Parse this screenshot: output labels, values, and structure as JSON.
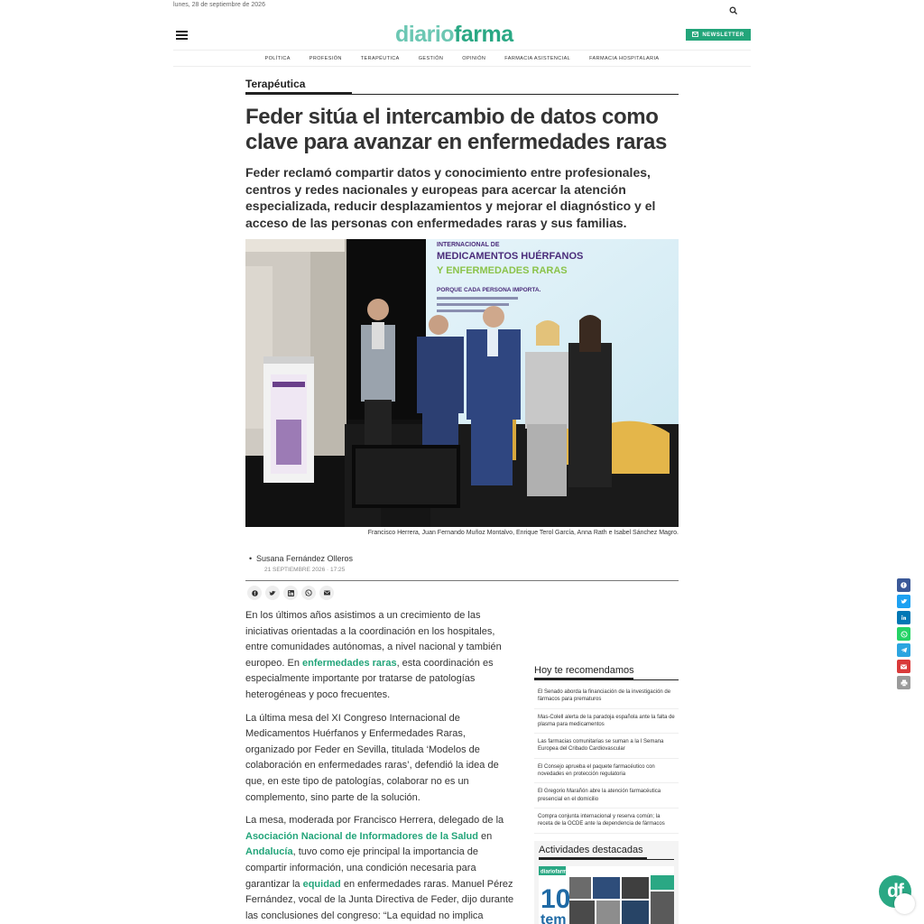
{
  "topbar": {
    "date": "lunes, 28 de septiembre de 2026"
  },
  "header": {
    "logo_part1": "diario",
    "logo_part2": "farma",
    "newsletter_label": "NEWSLETTER"
  },
  "nav": {
    "items": [
      "POLÍTICA",
      "PROFESIÓN",
      "TERAPÉUTICA",
      "GESTIÓN",
      "OPINIÓN",
      "FARMACIA ASISTENCIAL",
      "FARMACIA HOSPITALARIA"
    ]
  },
  "article": {
    "section": "Terapéutica",
    "title": "Feder sitúa el intercambio de datos como clave para avanzar en enfermedades raras",
    "subtitle": "Feder reclamó compartir datos y conocimiento entre profesionales, centros y redes nacionales y europeas para acercar la atención especializada, reducir desplazamientos y mejorar el diagnóstico y el acceso de las personas con enfermedades raras y sus familias.",
    "caption": "Francisco Herrera, Juan Fernando Muñoz Montalvo, Enrique Terol García, Anna Rath e Isabel Sánchez Magro.",
    "author": "Susana Fernández Olleros",
    "date": "21 SEPTIEMBRE 2026 · 17:25",
    "photo_text": {
      "l1": "INTERNACIONAL DE",
      "l2": "MEDICAMENTOS HUÉRFANOS",
      "l3": "Y ENFERMEDADES RARAS",
      "l4": "PORQUE CADA PERSONA IMPORTA."
    },
    "p1": {
      "a": "En los últimos años asistimos a un crecimiento de las iniciativas orientadas a la coordinación en los hospitales, entre comunidades autónomas, a nivel nacional y también europeo. En ",
      "link": "enfermedades raras",
      "b": ", esta coordinación es especialmente importante por tratarse de patologías heterogéneas y poco frecuentes."
    },
    "p2": "La última mesa del XI Congreso Internacional de Medicamentos Huérfanos y Enfermedades Raras, organizado por Feder en Sevilla, titulada ‘Modelos de colaboración en enfermedades raras’, defendió la idea de que, en este tipo de patologías, colaborar no es un complemento, sino parte de la solución.",
    "p3": {
      "a": "La mesa, moderada por Francisco Herrera, delegado de la ",
      "link1": "Asociación Nacional de Informadores de la Salud",
      "b": " en ",
      "link2": "Andalucía",
      "c": ", tuvo como eje principal la importancia de compartir información, una condición necesaria para garantizar la ",
      "link3": "equidad",
      "d": " en enfermedades raras. Manuel Pérez Fernández, vocal de la Junta Directiva de Feder, dijo durante las conclusiones del congreso: “La equidad no implica"
    }
  },
  "sidebar": {
    "reco_title": "Hoy te recomendamos",
    "reco_items": [
      "El Senado aborda la financiación de la investigación de fármacos para prematuros",
      "Mas-Colell alerta de la paradoja española ante la falta de plasma para medicamentos",
      "Las farmacias comunitarias se suman a la I Semana Europea del Cribado Cardiovascular",
      "El Consejo aprueba el paquete farmacéutico con novedades en protección regulatoria",
      "El Gregorio Marañón abre la atención farmacéutica presencial en el domicilio",
      "Compra conjunta internacional y reserva común; la receta de la OCDE ante la dependencia de fármacos"
    ],
    "act_title": "Actividades destacadas",
    "act_logo": "diariofarma",
    "act_big": "10",
    "act_big2": "tem"
  },
  "badge": {
    "text": "df"
  },
  "colors": {
    "brand": "#2aa884",
    "brand_light": "#6cc7b3",
    "link": "#23a57a"
  }
}
